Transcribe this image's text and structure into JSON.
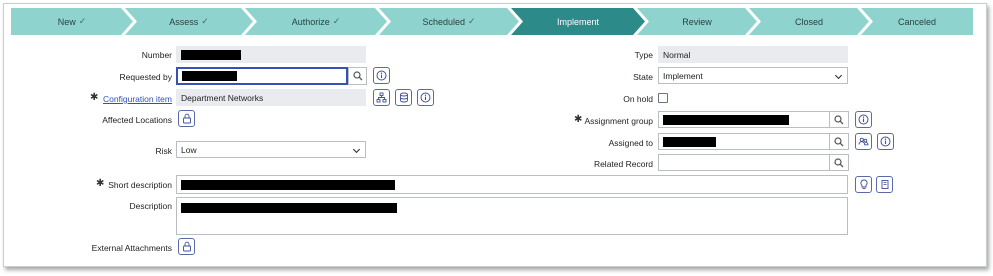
{
  "stages": [
    {
      "label": "New",
      "done": true
    },
    {
      "label": "Assess",
      "done": true
    },
    {
      "label": "Authorize",
      "done": true
    },
    {
      "label": "Scheduled",
      "done": true
    },
    {
      "label": "Implement",
      "done": false,
      "active": true
    },
    {
      "label": "Review",
      "done": false
    },
    {
      "label": "Closed",
      "done": false
    },
    {
      "label": "Canceled",
      "done": false
    }
  ],
  "form": {
    "number_label": "Number",
    "requested_by_label": "Requested by",
    "configuration_item_label": "Configuration item",
    "configuration_item_value": "Department Networks",
    "affected_locations_label": "Affected Locations",
    "risk_label": "Risk",
    "risk_value": "Low",
    "type_label": "Type",
    "type_value": "Normal",
    "state_label": "State",
    "state_value": "Implement",
    "on_hold_label": "On hold",
    "assignment_group_label": "Assignment group",
    "assigned_to_label": "Assigned to",
    "related_record_label": "Related Record",
    "short_description_label": "Short description",
    "description_label": "Description",
    "external_attachments_label": "External Attachments",
    "mandatory_marker": "✱"
  },
  "colors": {
    "stage_done": "#8fd3cf",
    "stage_active": "#2c8b88",
    "focus_border": "#3751b5"
  },
  "icons": [
    "search-icon",
    "info-icon",
    "hierarchy-icon",
    "database-icon",
    "lock-icon",
    "lightbulb-icon",
    "book-icon",
    "users-icon",
    "check-icon"
  ]
}
